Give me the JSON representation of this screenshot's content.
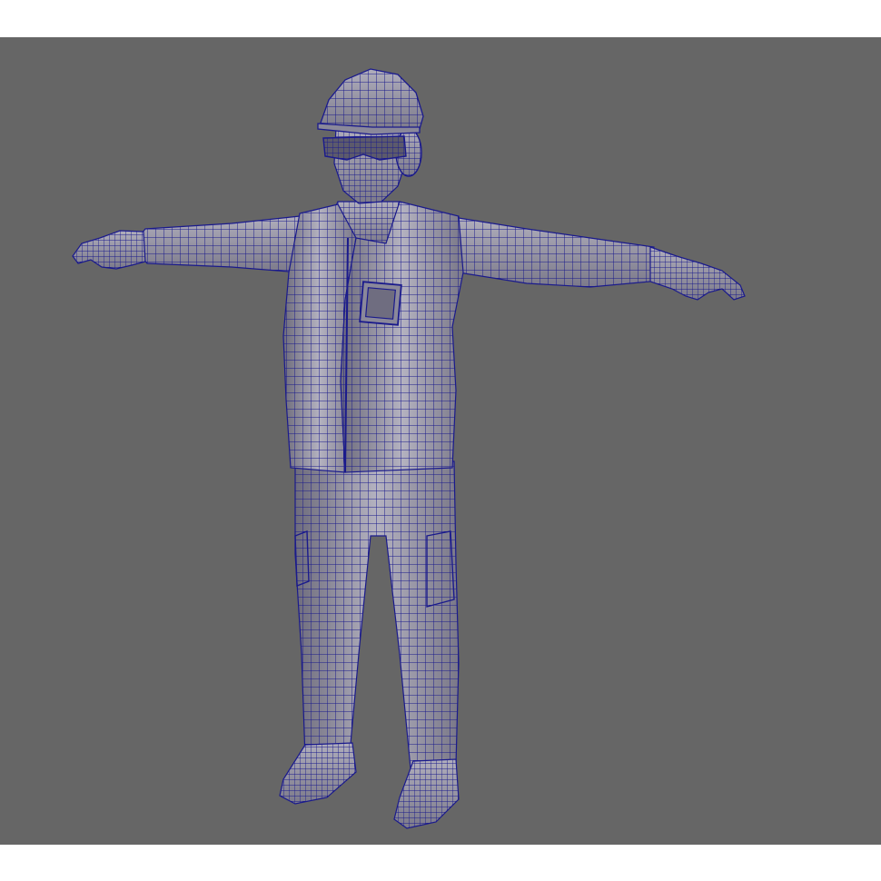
{
  "viewport": {
    "background_color": "#666666",
    "page_color": "#ffffff"
  },
  "model": {
    "pose": "T-pose",
    "display_mode": "wireframe-on-shaded",
    "surface_color": "#9c9aa8",
    "wire_color": "#1a1a8c",
    "parts": [
      "hard-hat",
      "safety-goggles",
      "ear-muffs",
      "head",
      "shirt-collar",
      "vest",
      "chest-pocket",
      "left-arm",
      "right-arm",
      "left-hand",
      "right-hand",
      "trousers",
      "left-boot",
      "right-boot"
    ]
  }
}
